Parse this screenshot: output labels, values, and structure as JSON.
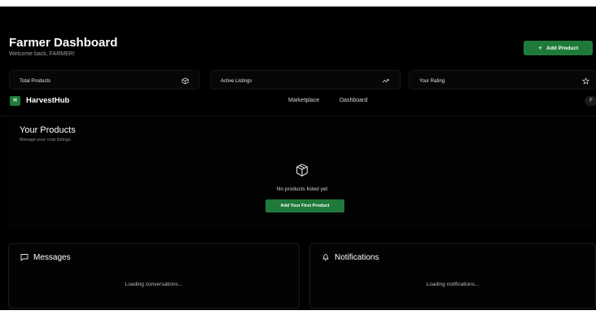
{
  "header": {
    "title": "Farmer Dashboard",
    "subtitle": "Welcome back, FARMER!",
    "add_product_label": "Add Product",
    "add_product_icon": "plus-icon"
  },
  "stats": [
    {
      "label": "Total Products",
      "icon": "box-icon"
    },
    {
      "label": "Active Listings",
      "icon": "trend-up-icon"
    },
    {
      "label": "Your Rating",
      "icon": "star-icon"
    }
  ],
  "navbar": {
    "logo_letter": "H",
    "brand": "HarvestHub",
    "links": [
      "Marketplace",
      "Dashboard"
    ],
    "user_initial": "F"
  },
  "products": {
    "title": "Your Products",
    "subtitle": "Manage your crop listings",
    "empty_text": "No products listed yet",
    "cta_label": "Add Your First Product"
  },
  "messages": {
    "title": "Messages",
    "status": "Loading conversations..."
  },
  "notifications": {
    "title": "Notifications",
    "status": "Loading notifications..."
  },
  "colors": {
    "accent": "#1f7a3a",
    "background": "#000000",
    "muted_text": "#9aa19d"
  }
}
